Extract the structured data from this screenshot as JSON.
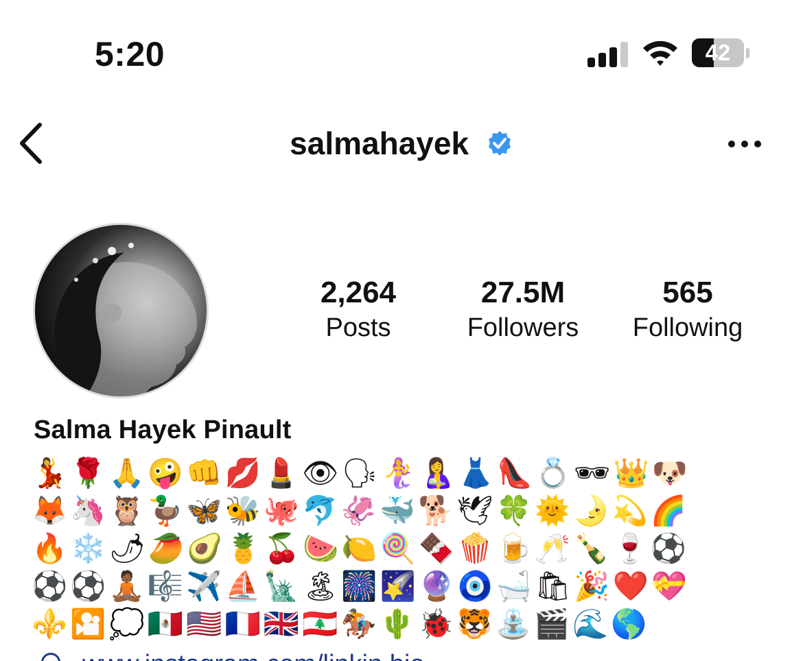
{
  "status_bar": {
    "time": "5:20",
    "battery_percent": "42",
    "battery_level": 0.42,
    "icons": [
      "signal-icon",
      "wifi-icon",
      "battery-icon"
    ]
  },
  "nav": {
    "username": "salmahayek",
    "verified": true,
    "icons": [
      "chevron-left-icon",
      "verified-badge-icon",
      "more-horizontal-icon"
    ]
  },
  "profile": {
    "full_name": "Salma Hayek Pinault",
    "stats": [
      {
        "value": "2,264",
        "label": "Posts"
      },
      {
        "value": "27.5M",
        "label": "Followers"
      },
      {
        "value": "565",
        "label": "Following"
      }
    ],
    "bio_lines": [
      "💃🌹🙏🤪👊💋💄👁🗣🧜‍♀️🤱👗👠💍🕶👑🐶",
      "🦊🦄🦉🦆🦋🐝🐙🐬🦑🐳🐕🕊🍀🌞🌛💫🌈",
      "🔥❄️🌶🥭🥑🍍🍒🍉🍋🍭🍫🍿🍺🥂🍾🍷⚽️",
      "⚽️⚽️🧘🏾🎼✈️⛵️🗽🏝🎆🌠🔮🧿🛁🛍🎉❤️💝",
      "⚜️🎦💭🇲🇽🇺🇸🇫🇷🇬🇧🇱🇧🏇🌵🐞🐯⛲️🎬🌊🌎"
    ],
    "link_text": "www.instagram.com/linkin.bio"
  },
  "colors": {
    "verified_blue": "#3897f0",
    "link_blue": "#1b3a8a",
    "text": "#111111",
    "background": "#ffffff"
  }
}
